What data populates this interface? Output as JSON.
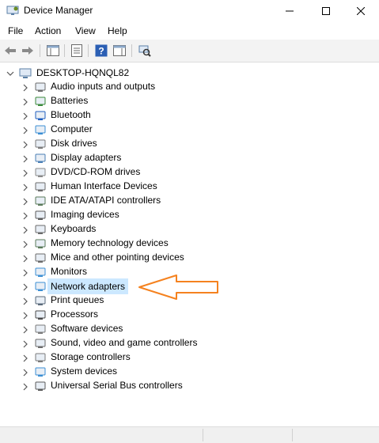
{
  "window": {
    "title": "Device Manager"
  },
  "menu": [
    "File",
    "Action",
    "View",
    "Help"
  ],
  "tree": {
    "root": "DESKTOP-HQNQL82",
    "categories": [
      {
        "label": "Audio inputs and outputs",
        "icon": "speaker-icon"
      },
      {
        "label": "Batteries",
        "icon": "battery-icon"
      },
      {
        "label": "Bluetooth",
        "icon": "bluetooth-icon"
      },
      {
        "label": "Computer",
        "icon": "computer-icon"
      },
      {
        "label": "Disk drives",
        "icon": "disk-drive-icon"
      },
      {
        "label": "Display adapters",
        "icon": "display-adapter-icon"
      },
      {
        "label": "DVD/CD-ROM drives",
        "icon": "dvd-icon"
      },
      {
        "label": "Human Interface Devices",
        "icon": "hid-icon"
      },
      {
        "label": "IDE ATA/ATAPI controllers",
        "icon": "ide-controller-icon"
      },
      {
        "label": "Imaging devices",
        "icon": "camera-icon"
      },
      {
        "label": "Keyboards",
        "icon": "keyboard-icon"
      },
      {
        "label": "Memory technology devices",
        "icon": "memory-icon"
      },
      {
        "label": "Mice and other pointing devices",
        "icon": "mouse-icon"
      },
      {
        "label": "Monitors",
        "icon": "monitor-icon"
      },
      {
        "label": "Network adapters",
        "icon": "network-adapter-icon",
        "selected": true
      },
      {
        "label": "Print queues",
        "icon": "printer-icon"
      },
      {
        "label": "Processors",
        "icon": "processor-icon"
      },
      {
        "label": "Software devices",
        "icon": "software-device-icon"
      },
      {
        "label": "Sound, video and game controllers",
        "icon": "sound-icon"
      },
      {
        "label": "Storage controllers",
        "icon": "storage-controller-icon"
      },
      {
        "label": "System devices",
        "icon": "system-device-icon"
      },
      {
        "label": "Universal Serial Bus controllers",
        "icon": "usb-icon"
      }
    ]
  },
  "annotation": {
    "color": "#f5821f",
    "points_to": "Network adapters"
  },
  "colors": {
    "selection": "#cce8ff",
    "toolbar": "#f3f3f3"
  }
}
